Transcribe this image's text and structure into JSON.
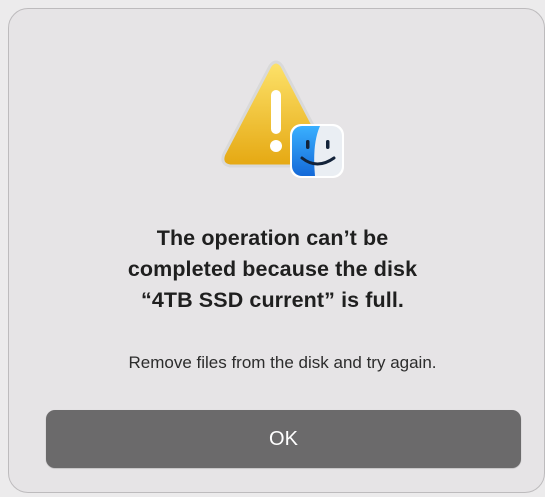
{
  "dialog": {
    "icon": "warning-triangle-with-finder-badge-icon",
    "title_lines": [
      "The operation can’t be",
      "completed because the disk",
      "“4TB SSD current” is full."
    ],
    "informative_text": "Remove files from the disk and try again.",
    "ok_button_label": "OK"
  },
  "colors": {
    "window_background": "#e6e4e6",
    "button_background": "#6b6a6b",
    "warning_yellow": "#f4c22b",
    "finder_blue": "#1e8ef0"
  }
}
